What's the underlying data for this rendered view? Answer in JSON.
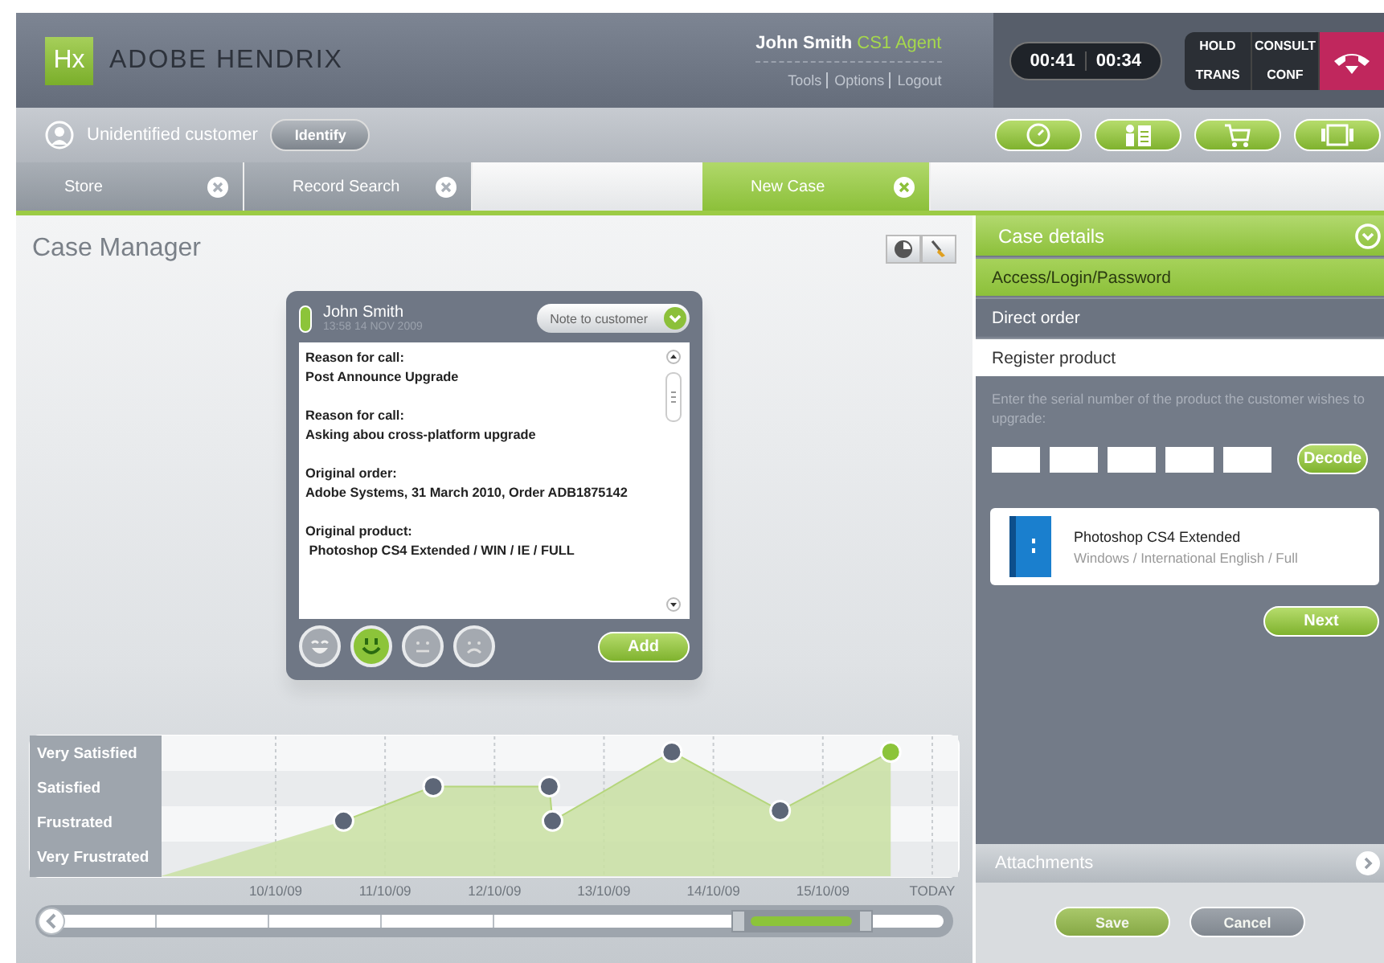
{
  "header": {
    "logo_mark": "Hx",
    "app_name": "ADOBE HENDRIX",
    "user": {
      "name": "John Smith",
      "role": "CS1 Agent"
    },
    "links": [
      "Tools",
      "Options",
      "Logout"
    ],
    "timers": [
      "00:41",
      "00:34"
    ],
    "call_buttons": [
      "HOLD",
      "CONSULT",
      "TRANS",
      "CONF"
    ]
  },
  "customer": {
    "status": "Unidentified customer",
    "identify_button": "Identify"
  },
  "tabs": [
    {
      "label": "Store",
      "selected": false
    },
    {
      "label": "Record Search",
      "selected": false
    },
    {
      "label": "New Case",
      "selected": true
    }
  ],
  "case_manager": {
    "title": "Case Manager",
    "note": {
      "author": "John Smith",
      "timestamp": "13:58 14 NOV 2009",
      "note_type": "Note to customer",
      "add_button": "Add",
      "entries": [
        {
          "label": "Reason for call:",
          "value": "Post Announce Upgrade"
        },
        {
          "label": "Reason for call:",
          "value": "Asking abou cross-platform upgrade"
        },
        {
          "label": "Original order:",
          "value": "Adobe Systems, 31 March 2010, Order ADB1875142"
        },
        {
          "label": "Original product:",
          "value": " Photoshop CS4 Extended / WIN / IE / FULL"
        }
      ],
      "moods": [
        {
          "kind": "laughing",
          "selected": false
        },
        {
          "kind": "smiling",
          "selected": true
        },
        {
          "kind": "neutral",
          "selected": false
        },
        {
          "kind": "sad",
          "selected": false
        }
      ]
    },
    "satisfaction_chart": {
      "levels": [
        "Very Satisfied",
        "Satisfied",
        "Frustrated",
        "Very Frustrated"
      ],
      "dates": [
        "10/10/09",
        "11/10/09",
        "12/10/09",
        "13/10/09",
        "14/10/09",
        "15/10/09",
        "TODAY"
      ]
    }
  },
  "case_details": {
    "title": "Case details",
    "expanded": true,
    "sections": [
      {
        "label": "Access/Login/Password",
        "completed": true,
        "selected": false
      },
      {
        "label": "Direct order",
        "completed": false,
        "selected": false
      },
      {
        "label": "Register product",
        "completed": false,
        "selected": true
      }
    ],
    "instructions": "Enter the serial number of the product the customer wishes to upgrade:",
    "serial_fields": [
      {
        "filled": false
      },
      {
        "filled": false
      },
      {
        "filled": false
      },
      {
        "filled": false
      },
      {
        "filled": false
      }
    ],
    "decode_button": "Decode",
    "product": {
      "name": "Photoshop CS4 Extended",
      "details": "Windows / International English / Full"
    },
    "next_button": "Next"
  },
  "attachments": {
    "title": "Attachments",
    "expanded": false
  },
  "footer_buttons": [
    {
      "label": "Save",
      "kind": "primary",
      "disabled": true
    },
    {
      "label": "Cancel",
      "kind": "secondary",
      "disabled": true
    }
  ]
}
